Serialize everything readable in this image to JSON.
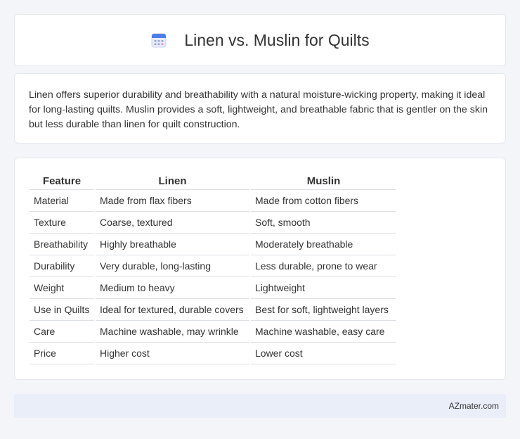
{
  "header": {
    "title": "Linen vs. Muslin for Quilts",
    "icon": "calendar-icon"
  },
  "summary": {
    "text": "Linen offers superior durability and breathability with a natural moisture-wicking property, making it ideal for long-lasting quilts. Muslin provides a soft, lightweight, and breathable fabric that is gentler on the skin but less durable than linen for quilt construction."
  },
  "table": {
    "headers": [
      "Feature",
      "Linen",
      "Muslin"
    ],
    "rows": [
      [
        "Material",
        "Made from flax fibers",
        "Made from cotton fibers"
      ],
      [
        "Texture",
        "Coarse, textured",
        "Soft, smooth"
      ],
      [
        "Breathability",
        "Highly breathable",
        "Moderately breathable"
      ],
      [
        "Durability",
        "Very durable, long-lasting",
        "Less durable, prone to wear"
      ],
      [
        "Weight",
        "Medium to heavy",
        "Lightweight"
      ],
      [
        "Use in Quilts",
        "Ideal for textured, durable covers",
        "Best for soft, lightweight layers"
      ],
      [
        "Care",
        "Machine washable, may wrinkle",
        "Machine washable, easy care"
      ],
      [
        "Price",
        "Higher cost",
        "Lower cost"
      ]
    ]
  },
  "footer": {
    "text": "AZmater.com"
  }
}
